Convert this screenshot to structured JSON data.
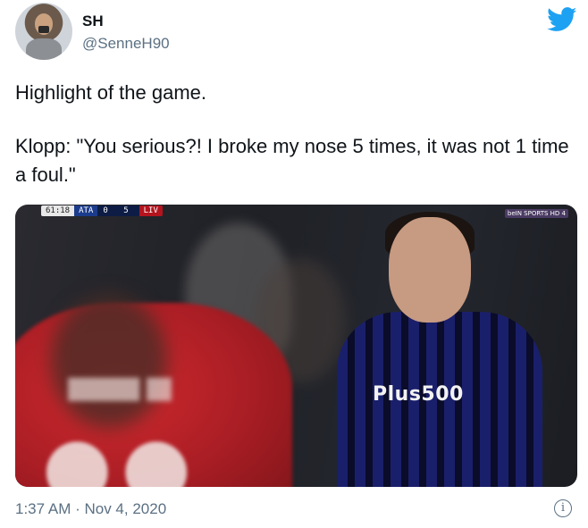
{
  "author": {
    "name": "SH",
    "handle": "@SenneH90"
  },
  "tweet": {
    "line1": "Highlight of the game.",
    "line2": "Klopp: \"You serious?! I broke my nose 5 times, it was not 1 time a foul.\""
  },
  "media": {
    "scorebug": {
      "time": "61:18",
      "home": "ATA",
      "score": "0 5",
      "away": "LIV"
    },
    "channel": "beIN SPORTS HD 4",
    "sponsor": "Plus500"
  },
  "footer": {
    "timestamp": "1:37 AM · Nov 4, 2020"
  },
  "colors": {
    "twitter_blue": "#1da1f2",
    "secondary_text": "#5b7083"
  }
}
